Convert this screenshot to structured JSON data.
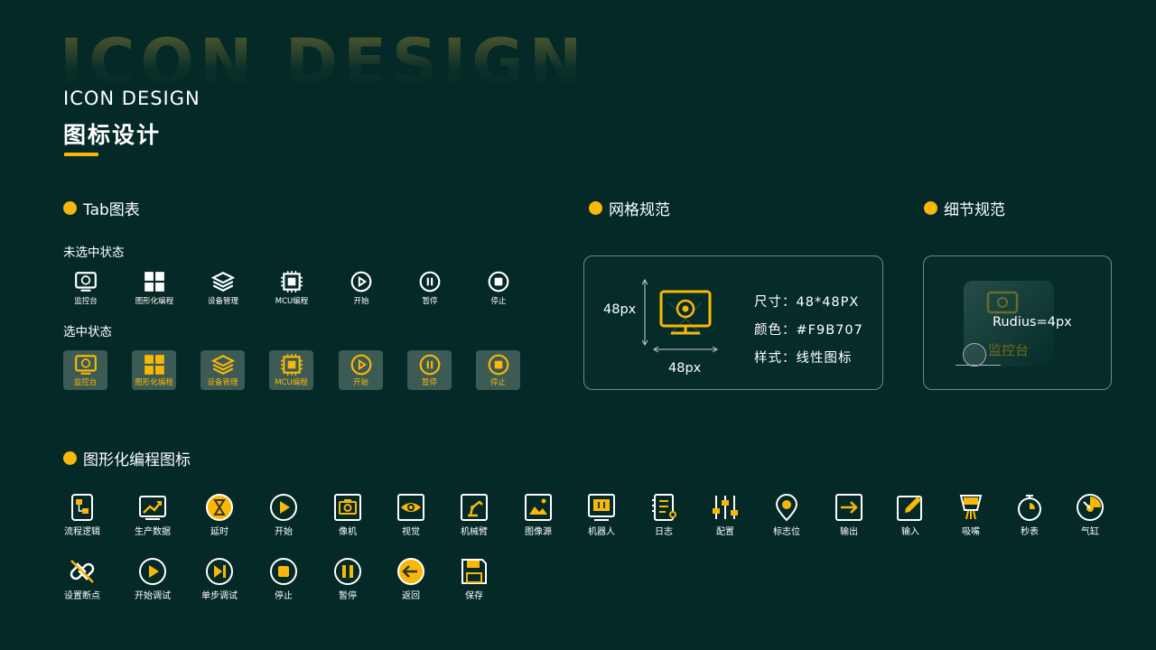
{
  "header": {
    "bg_title": "ICON DESIGN",
    "title_en": "ICON DESIGN",
    "title_cn": "图标设计"
  },
  "sections": {
    "tab": "Tab图表",
    "grid": "网格规范",
    "detail": "细节规范",
    "graphic": "图形化编程图标"
  },
  "tab_section": {
    "unselected_label": "未选中状态",
    "selected_label": "选中状态",
    "items": [
      {
        "label": "监控台",
        "icon": "monitor-icon"
      },
      {
        "label": "图形化编程",
        "icon": "grid-blocks-icon"
      },
      {
        "label": "设备管理",
        "icon": "layers-icon"
      },
      {
        "label": "MCU编程",
        "icon": "chip-icon"
      },
      {
        "label": "开始",
        "icon": "play-icon"
      },
      {
        "label": "暂停",
        "icon": "pause-icon"
      },
      {
        "label": "停止",
        "icon": "stop-icon"
      }
    ]
  },
  "grid_spec": {
    "height_label": "48px",
    "width_label": "48px",
    "size": "尺寸：48*48PX",
    "color": "颜色：#F9B707",
    "style": "样式：线性图标"
  },
  "detail_spec": {
    "radius": "Rudius=4px",
    "sample_label": "监控台"
  },
  "graphic_icons": {
    "row1": [
      {
        "label": "流程逻辑",
        "icon": "flow-logic-icon"
      },
      {
        "label": "生产数据",
        "icon": "production-data-icon"
      },
      {
        "label": "延时",
        "icon": "hourglass-icon"
      },
      {
        "label": "开始",
        "icon": "play-icon"
      },
      {
        "label": "像机",
        "icon": "camera-icon"
      },
      {
        "label": "视觉",
        "icon": "eye-icon"
      },
      {
        "label": "机械臂",
        "icon": "robot-arm-icon"
      },
      {
        "label": "图像源",
        "icon": "image-icon"
      },
      {
        "label": "机器人",
        "icon": "robot-icon"
      },
      {
        "label": "日志",
        "icon": "log-icon"
      },
      {
        "label": "配置",
        "icon": "sliders-icon"
      },
      {
        "label": "标志位",
        "icon": "location-pin-icon"
      },
      {
        "label": "输出",
        "icon": "output-icon"
      },
      {
        "label": "输入",
        "icon": "input-edit-icon"
      },
      {
        "label": "吸嘴",
        "icon": "nozzle-icon"
      },
      {
        "label": "秒表",
        "icon": "stopwatch-icon"
      },
      {
        "label": "气缸",
        "icon": "gauge-icon"
      }
    ],
    "row2": [
      {
        "label": "设置断点",
        "icon": "breakpoint-icon"
      },
      {
        "label": "开始调试",
        "icon": "debug-play-icon"
      },
      {
        "label": "单步调试",
        "icon": "step-icon"
      },
      {
        "label": "停止",
        "icon": "stop-icon"
      },
      {
        "label": "暂停",
        "icon": "pause-icon"
      },
      {
        "label": "返回",
        "icon": "back-icon"
      },
      {
        "label": "保存",
        "icon": "save-icon"
      }
    ]
  },
  "colors": {
    "background": "#042926",
    "accent": "#F9B707",
    "selected_bg": "#3b5b54",
    "card_border": "#6f8985"
  }
}
